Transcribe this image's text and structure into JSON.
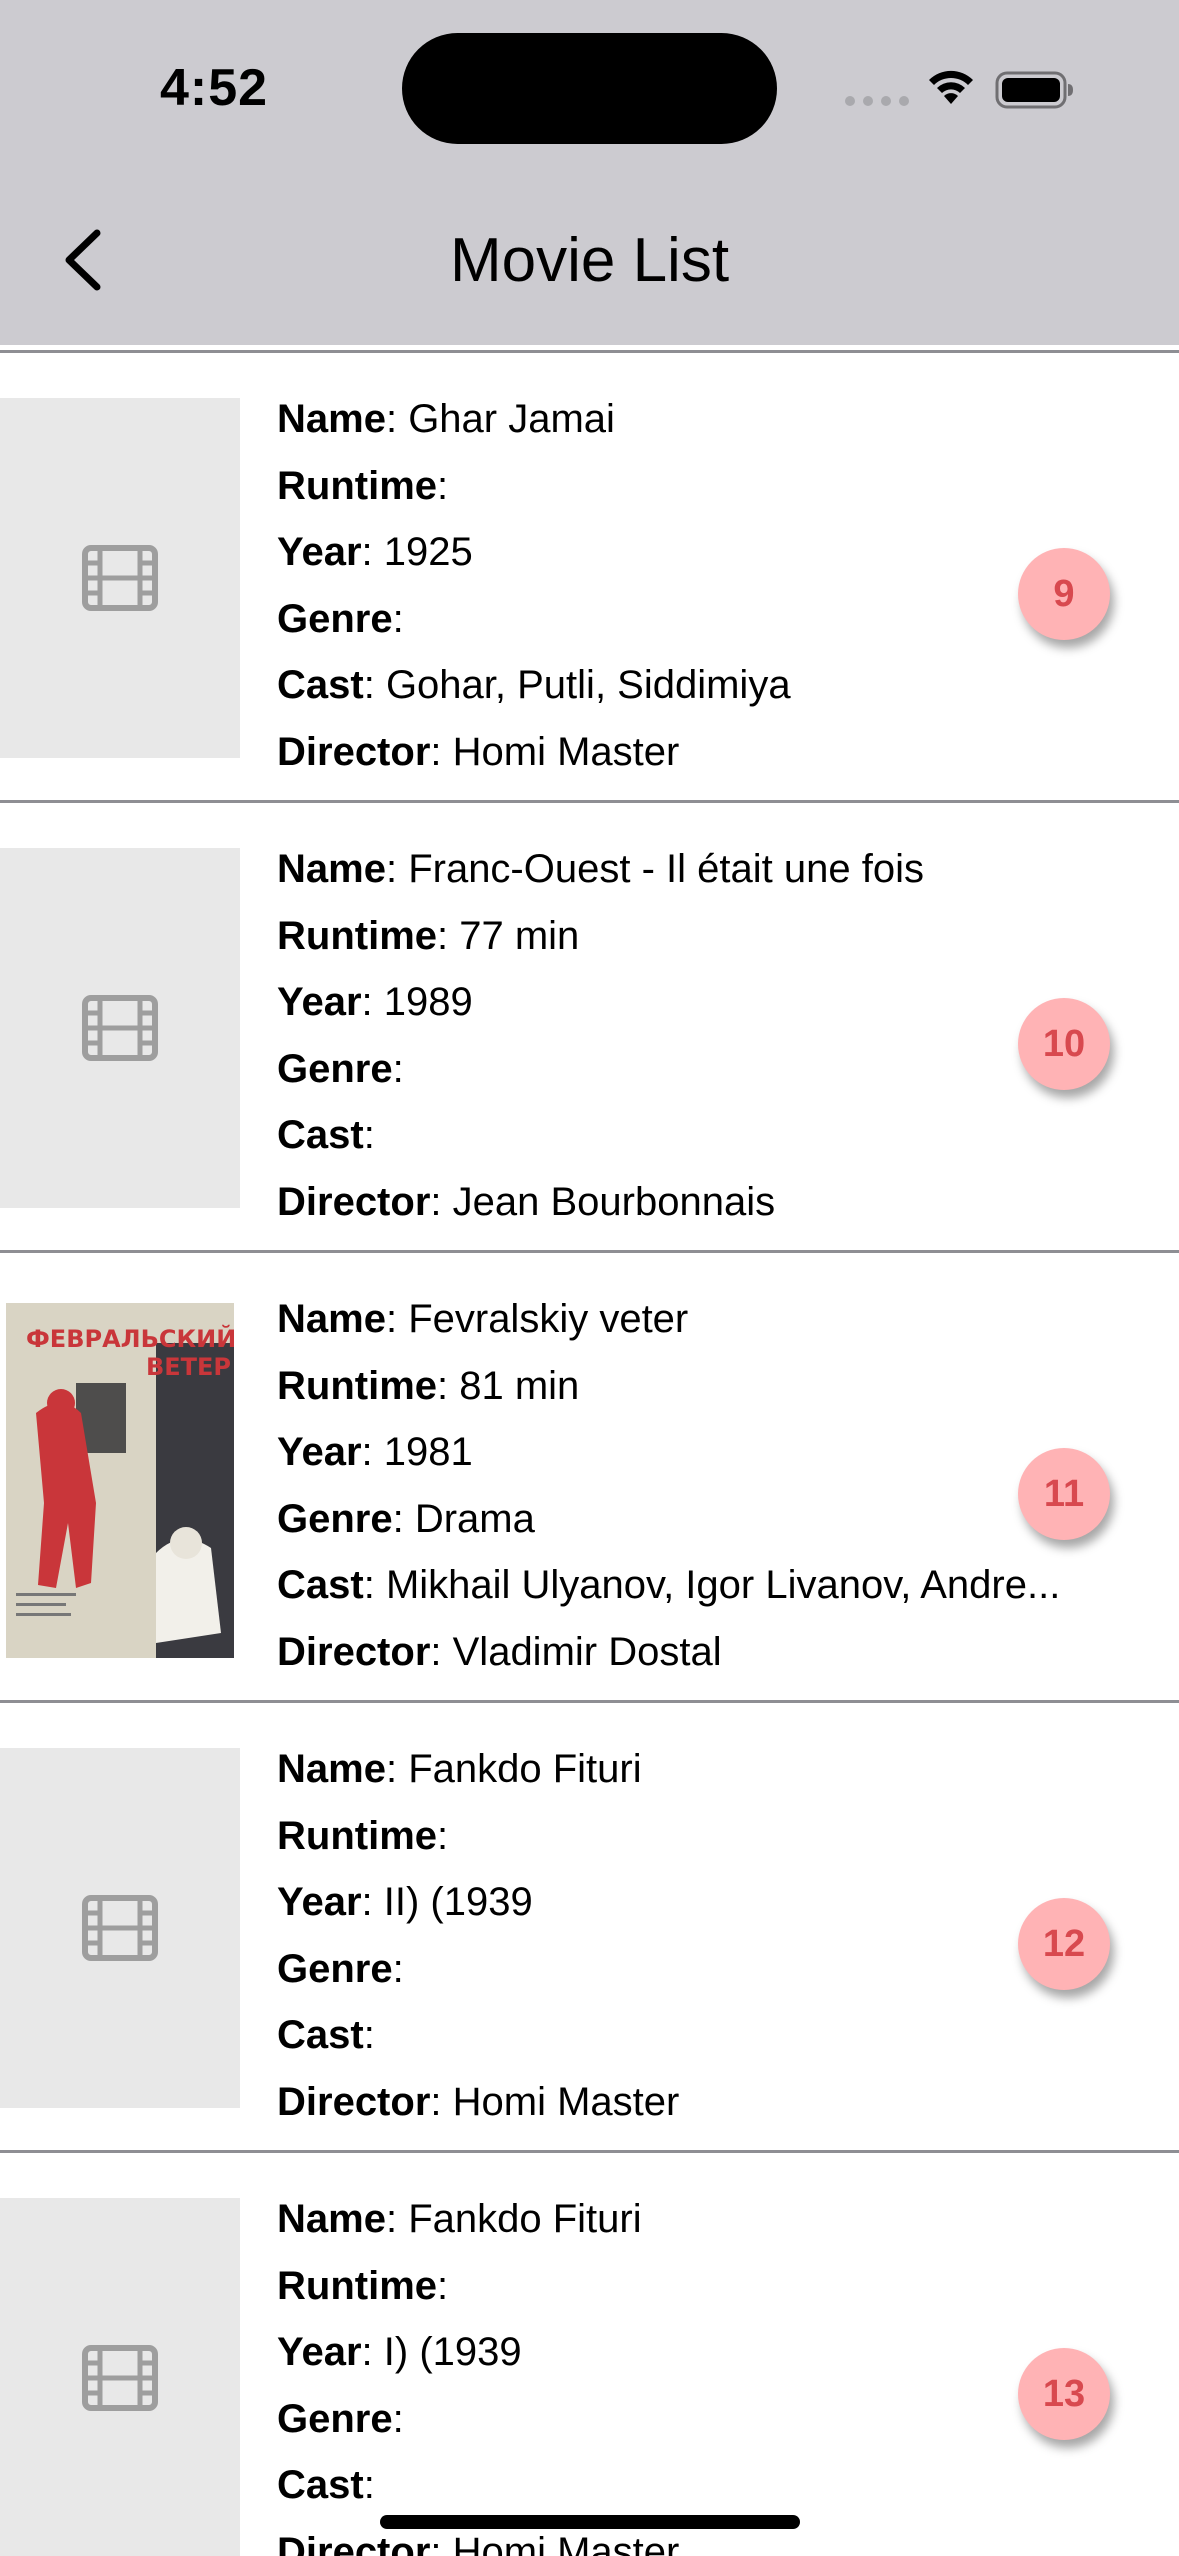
{
  "status_bar": {
    "time": "4:52"
  },
  "nav": {
    "title": "Movie List"
  },
  "labels": {
    "name": "Name",
    "runtime": "Runtime",
    "year": "Year",
    "genre": "Genre",
    "cast": "Cast",
    "director": "Director"
  },
  "movies": [
    {
      "name": "Ghar Jamai",
      "runtime": "",
      "year": "1925",
      "genre": "",
      "cast": "Gohar, Putli, Siddimiya",
      "director": "Homi Master",
      "rank": "9",
      "has_poster": false
    },
    {
      "name": "Franc-Ouest - Il était une fois",
      "runtime": "77 min",
      "year": "1989",
      "genre": "",
      "cast": "",
      "director": "Jean Bourbonnais",
      "rank": "10",
      "has_poster": false
    },
    {
      "name": "Fevralskiy veter",
      "runtime": "81 min",
      "year": "1981",
      "genre": "Drama",
      "cast": "Mikhail Ulyanov, Igor Livanov, Andre...",
      "director": "Vladimir Dostal",
      "rank": "11",
      "has_poster": true,
      "poster_title": "ФЕВРАЛЬСКИЙ ВЕТЕР"
    },
    {
      "name": "Fankdo Fituri",
      "runtime": "",
      "year": "II) (1939",
      "genre": "",
      "cast": "",
      "director": "Homi Master",
      "rank": "12",
      "has_poster": false
    },
    {
      "name": "Fankdo Fituri",
      "runtime": "",
      "year": "I) (1939",
      "genre": "",
      "cast": "",
      "director": "Homi Master",
      "rank": "13",
      "has_poster": false
    }
  ],
  "colors": {
    "header_bg": "#cccbd0",
    "badge_bg": "#ffb3b5",
    "badge_text": "#d8494f",
    "divider": "#8e8e93",
    "placeholder_bg": "#e8e8e8",
    "placeholder_icon": "#9e9e9e"
  },
  "icons": [
    "back-chevron-icon",
    "wifi-icon",
    "battery-icon",
    "cellular-dots-icon",
    "film-icon"
  ]
}
